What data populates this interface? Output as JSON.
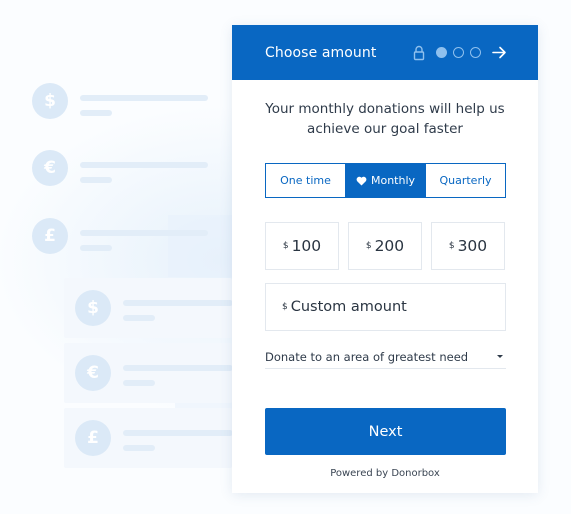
{
  "background": {
    "currency_rows": [
      {
        "symbol": "$"
      },
      {
        "symbol": "€"
      },
      {
        "symbol": "£"
      },
      {
        "symbol": "$"
      },
      {
        "symbol": "€"
      },
      {
        "symbol": "£"
      }
    ]
  },
  "header": {
    "title": "Choose amount",
    "steps_total": 3,
    "current_step": 1
  },
  "message": "Your monthly donations will help us achieve our goal faster",
  "frequency": {
    "options": [
      "One time",
      "Monthly",
      "Quarterly"
    ],
    "selected": "Monthly"
  },
  "amounts": [
    {
      "currency": "$",
      "value": "100"
    },
    {
      "currency": "$",
      "value": "200"
    },
    {
      "currency": "$",
      "value": "300"
    }
  ],
  "custom_amount": {
    "currency": "$",
    "placeholder": "Custom amount"
  },
  "designation": {
    "selected": "Donate to an area of greatest need"
  },
  "next_button": {
    "label": "Next"
  },
  "footer": {
    "powered_by": "Powered by Donorbox"
  },
  "colors": {
    "primary": "#0967c2",
    "header_dots": "#8fc0ee"
  }
}
